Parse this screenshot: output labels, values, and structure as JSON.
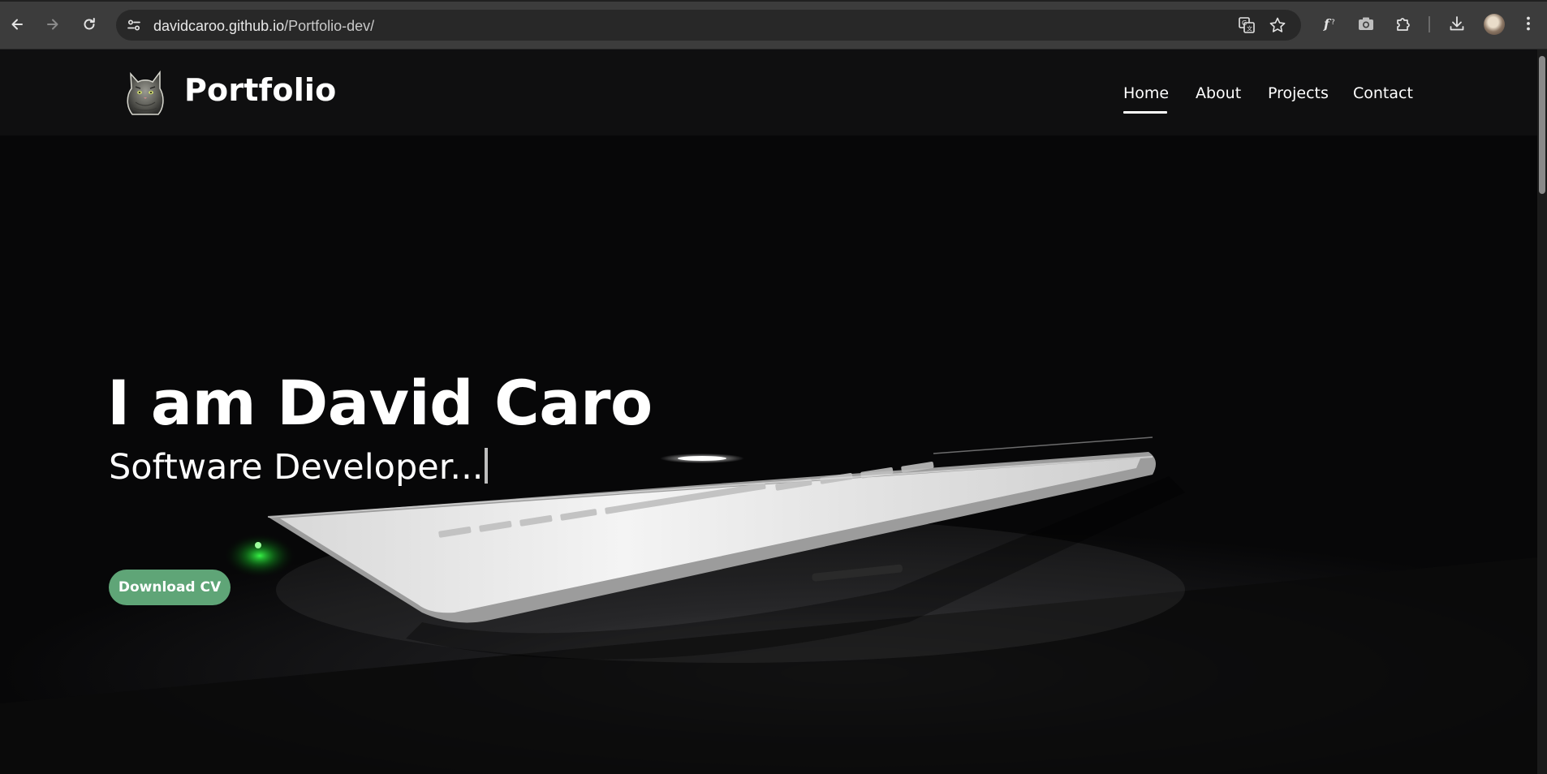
{
  "browser": {
    "url_host": "davidcaroo.github.io",
    "url_path": "/Portfolio-dev/",
    "icons": {
      "back": "arrow-left-icon",
      "forward": "arrow-right-icon",
      "reload": "reload-icon",
      "site_info": "site-info-icon",
      "translate": "translate-icon",
      "bookmark": "star-icon",
      "fonts": "font-icon",
      "screenshot": "camera-icon",
      "extensions": "puzzle-icon",
      "downloads": "download-icon",
      "profile": "avatar-icon",
      "menu": "kebab-menu-icon"
    }
  },
  "site": {
    "brand": "Portfolio",
    "nav": [
      {
        "label": "Home",
        "active": true
      },
      {
        "label": "About",
        "active": false
      },
      {
        "label": "Projects",
        "active": false
      },
      {
        "label": "Contact",
        "active": false
      }
    ]
  },
  "hero": {
    "title": "I am David Caro",
    "subtitle": "Software Developer...",
    "cta_label": "Download CV",
    "cta_color": "#5fa577"
  }
}
